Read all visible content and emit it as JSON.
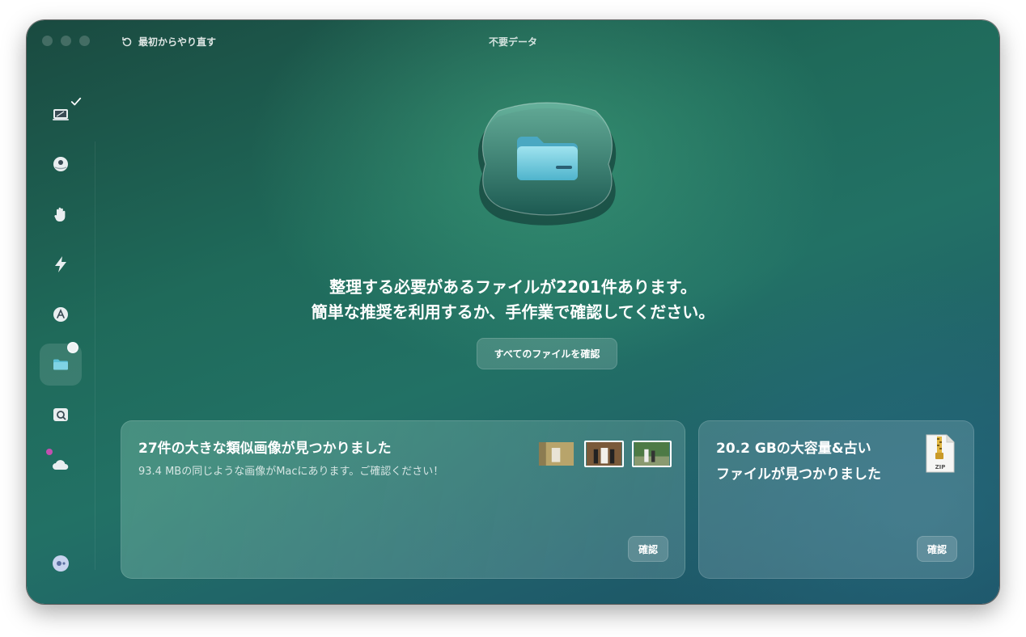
{
  "window": {
    "title": "不要データ"
  },
  "toolbar": {
    "restart_label": "最初からやり直す"
  },
  "sidebar": {
    "items": [
      {
        "icon": "cleanup-icon",
        "checked": true
      },
      {
        "icon": "protection-icon"
      },
      {
        "icon": "privacy-hand-icon"
      },
      {
        "icon": "speed-bolt-icon"
      },
      {
        "icon": "applications-icon"
      },
      {
        "icon": "my-clutter-folder-icon",
        "active": true
      },
      {
        "icon": "space-lens-icon"
      },
      {
        "icon": "cloud-icon",
        "badge": true
      },
      {
        "icon": "assistant-icon"
      }
    ]
  },
  "main": {
    "message_line1": "整理する必要があるファイルが2201件あります。",
    "message_line2": "簡単な推奨を利用するか、手作業で確認してください。",
    "review_all_label": "すべてのファイルを確認"
  },
  "cards": {
    "similar": {
      "title": "27件の大きな類似画像が見つかりました",
      "subtitle": "93.4 MBの同じような画像がMacにあります。ご確認ください！",
      "button": "確認"
    },
    "large_old": {
      "title_line1": "20.2 GBの大容量&古い",
      "title_line2": "ファイルが見つかりました",
      "zip_label": "ZIP",
      "button": "確認"
    }
  },
  "colors": {
    "accent_folder": "#5bc0d6",
    "badge": "#c34fb0"
  }
}
